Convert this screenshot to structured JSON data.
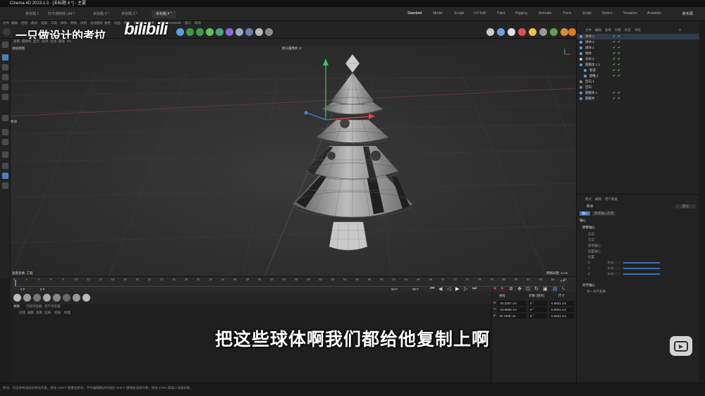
{
  "window": {
    "title": "Cinema 4D 2023.1.3 - [未标题 4 *] - 主要"
  },
  "doc_tabs": [
    "未标题 1",
    "扫卡通特效.c4d *",
    "未标题 2 *",
    "未标题 3 *",
    "未标题 4 *"
  ],
  "layout_tabs": [
    "Standard",
    "Model",
    "Sculpt",
    "UV Edit",
    "Paint",
    "Rigging",
    "Animate",
    "Track",
    "Script",
    "Nodes",
    "Visualize",
    "Available"
  ],
  "new_layout_label": "新布局",
  "main_menu": [
    "文件",
    "编辑",
    "创建",
    "模式",
    "选择",
    "工具",
    "样条",
    "网格",
    "体积",
    "运动图形",
    "角色",
    "动画",
    "模拟",
    "跟踪器",
    "渲染",
    "扩展",
    "Redshift",
    "窗口",
    "帮助"
  ],
  "viewport": {
    "menu": [
      "查看",
      "摄像机",
      "显示",
      "选项",
      "过滤",
      "面板",
      "RS"
    ],
    "title": "透视视图",
    "camera_label": "默认摄像机 ↺",
    "move_label": "移动",
    "bottom_left": "查看变换: 工程",
    "bottom_right": "网格间距: 5 cm"
  },
  "timeline": {
    "ticks": [
      0,
      2,
      4,
      6,
      8,
      10,
      12,
      14,
      16,
      18,
      20,
      22,
      24,
      26,
      28,
      30,
      32,
      34,
      36,
      38,
      40,
      42,
      44,
      46,
      48,
      50,
      52,
      54,
      56,
      58,
      60,
      62,
      64,
      66,
      68,
      70,
      72,
      74,
      76,
      78,
      80,
      82,
      84,
      86,
      88,
      90
    ],
    "current_frame": "0 F",
    "start_frame": "0 F",
    "end_frame": "90 F",
    "end_frame2": "90 F",
    "frame_right": "0 F"
  },
  "materials": {
    "menu": [
      "材质",
      "内容浏览器",
      "资产浏览器"
    ],
    "submenu": [
      "创建",
      "编辑",
      "查看",
      "选择",
      "材质",
      "纹理"
    ]
  },
  "coords": {
    "headers": [
      "坐标",
      "对象 (相对)",
      "尺寸"
    ],
    "rows": [
      {
        "axis": "X",
        "pos": "-20.3267 cm",
        "rot": "0 °",
        "size": "5.6921 cm"
      },
      {
        "axis": "Y",
        "pos": "-23.8885 cm",
        "rot": "0 °",
        "size": "5.6921 cm"
      },
      {
        "axis": "Z",
        "pos": "10.7469 cm",
        "rot": "0 °",
        "size": "5.6921 cm"
      }
    ]
  },
  "object_manager": {
    "menu": [
      "文件",
      "编辑",
      "查看",
      "对象",
      "标签",
      "书签"
    ],
    "objects": [
      "球体.3",
      "球体.2",
      "球体.1",
      "球体",
      "文本.8",
      "圆锥体.1.1",
      "管道",
      "圆锥.1",
      "空白.1",
      "空白",
      "圆锥体.1",
      "圆锥体"
    ]
  },
  "attribute_manager": {
    "menu": [
      "模式",
      "编辑",
      "用户数据"
    ],
    "title": "移动",
    "tabs": [
      "轴心",
      "建模轴心选项"
    ],
    "section": "轴心",
    "subsection": "建模轴心",
    "dropdown": "默认",
    "fields": [
      "方向",
      "方向",
      "修改轴心",
      "位置轴心",
      "位置",
      "X",
      "Y",
      "Z"
    ],
    "values": [
      "0 %",
      "0 %",
      "0 %"
    ],
    "section2": "对齐轴心",
    "checkbox": "单一对齐变换"
  },
  "status_text": "移动：点击并拖动鼠标移动元素。按住 SHIFT 键量化移动；节点编辑模式时按住 SHIFT 键增加选择对象；按住 CTRL 键减少选择对象。",
  "watermark": {
    "uploader": "一只做设计的考拉",
    "logo": "bilibili"
  },
  "subtitle": "把这些球体啊我们都给他复制上啊"
}
